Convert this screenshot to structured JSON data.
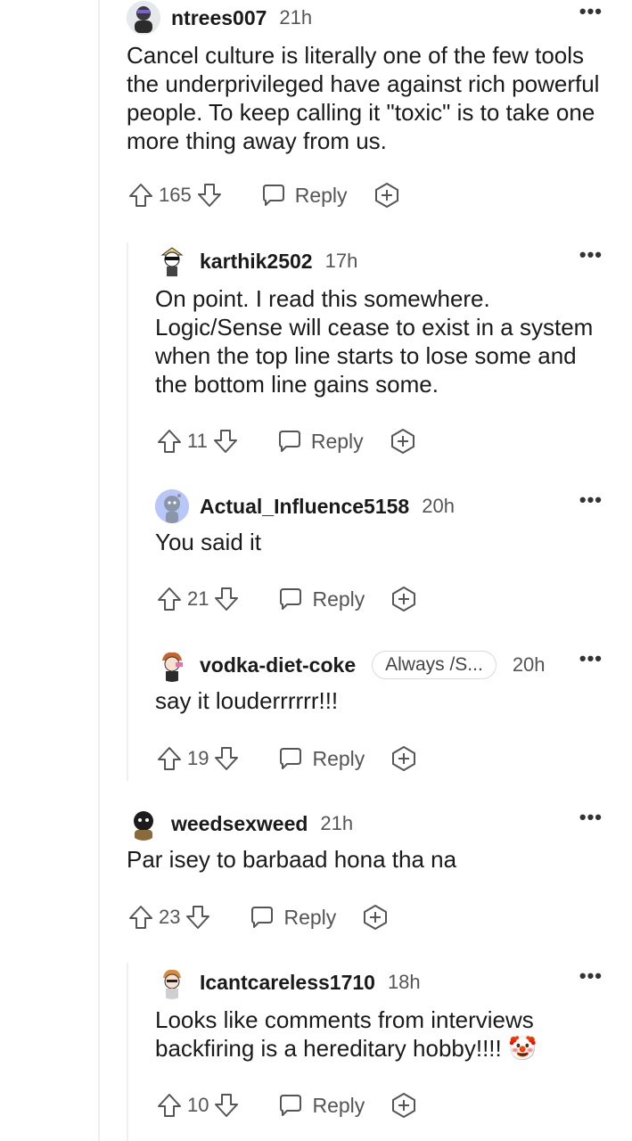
{
  "comments": [
    {
      "username": "ntrees007",
      "time": "21h",
      "body": "Cancel culture is literally one of the few tools the underprivileged have against rich powerful people. To keep calling it \"toxic\" is to take one more thing away from us.",
      "votes": "165",
      "reply_label": "Reply",
      "more": "•••"
    },
    {
      "username": "karthik2502",
      "time": "17h",
      "body": "On point. I read this somewhere. Logic/Sense will cease to exist in a system when the top line starts to lose some and the bottom line gains some.",
      "votes": "11",
      "reply_label": "Reply",
      "more": "•••"
    },
    {
      "username": "Actual_Influence5158",
      "time": "20h",
      "body": "You said it",
      "votes": "21",
      "reply_label": "Reply",
      "more": "•••"
    },
    {
      "username": "vodka-diet-coke",
      "flair": "Always /S...",
      "time": "20h",
      "body": "say it louderrrrrr!!!",
      "votes": "19",
      "reply_label": "Reply",
      "more": "•••"
    },
    {
      "username": "weedsexweed",
      "time": "21h",
      "body": "Par isey to barbaad hona tha na",
      "votes": "23",
      "reply_label": "Reply",
      "more": "•••"
    },
    {
      "username": "Icantcareless1710",
      "time": "18h",
      "body": "Looks like comments from interviews backfiring is a hereditary hobby!!!! 🤡",
      "votes": "10",
      "reply_label": "Reply",
      "more": "•••"
    }
  ],
  "icons": {
    "upvote": "upvote-arrow-icon",
    "downvote": "downvote-arrow-icon",
    "reply": "speech-bubble-icon",
    "award": "award-plus-icon",
    "more": "more-options-icon"
  }
}
